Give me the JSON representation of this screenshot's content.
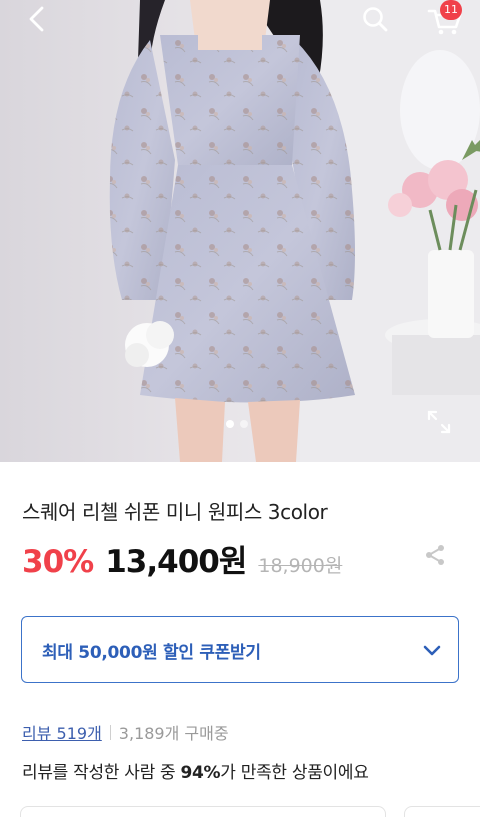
{
  "header": {
    "cart_count": "11"
  },
  "gallery": {
    "slides_total": 2,
    "active_index": 0
  },
  "product": {
    "title": "스퀘어 리첼 쉬폰 미니 원피스 3color",
    "discount": "30%",
    "price": "13,400원",
    "original_price": "18,900원"
  },
  "coupon": {
    "label": "최대 50,000원 할인 쿠폰받기"
  },
  "reviews": {
    "link_label": "리뷰 519개",
    "buyers": "3,189개 구매중"
  },
  "satisfaction": {
    "prefix": "리뷰를 작성한 사람 중 ",
    "percent": "94%",
    "suffix": "가 만족한 상품이에요"
  },
  "colors": {
    "accent_red": "#f0414a",
    "accent_blue": "#2d5fb8"
  }
}
